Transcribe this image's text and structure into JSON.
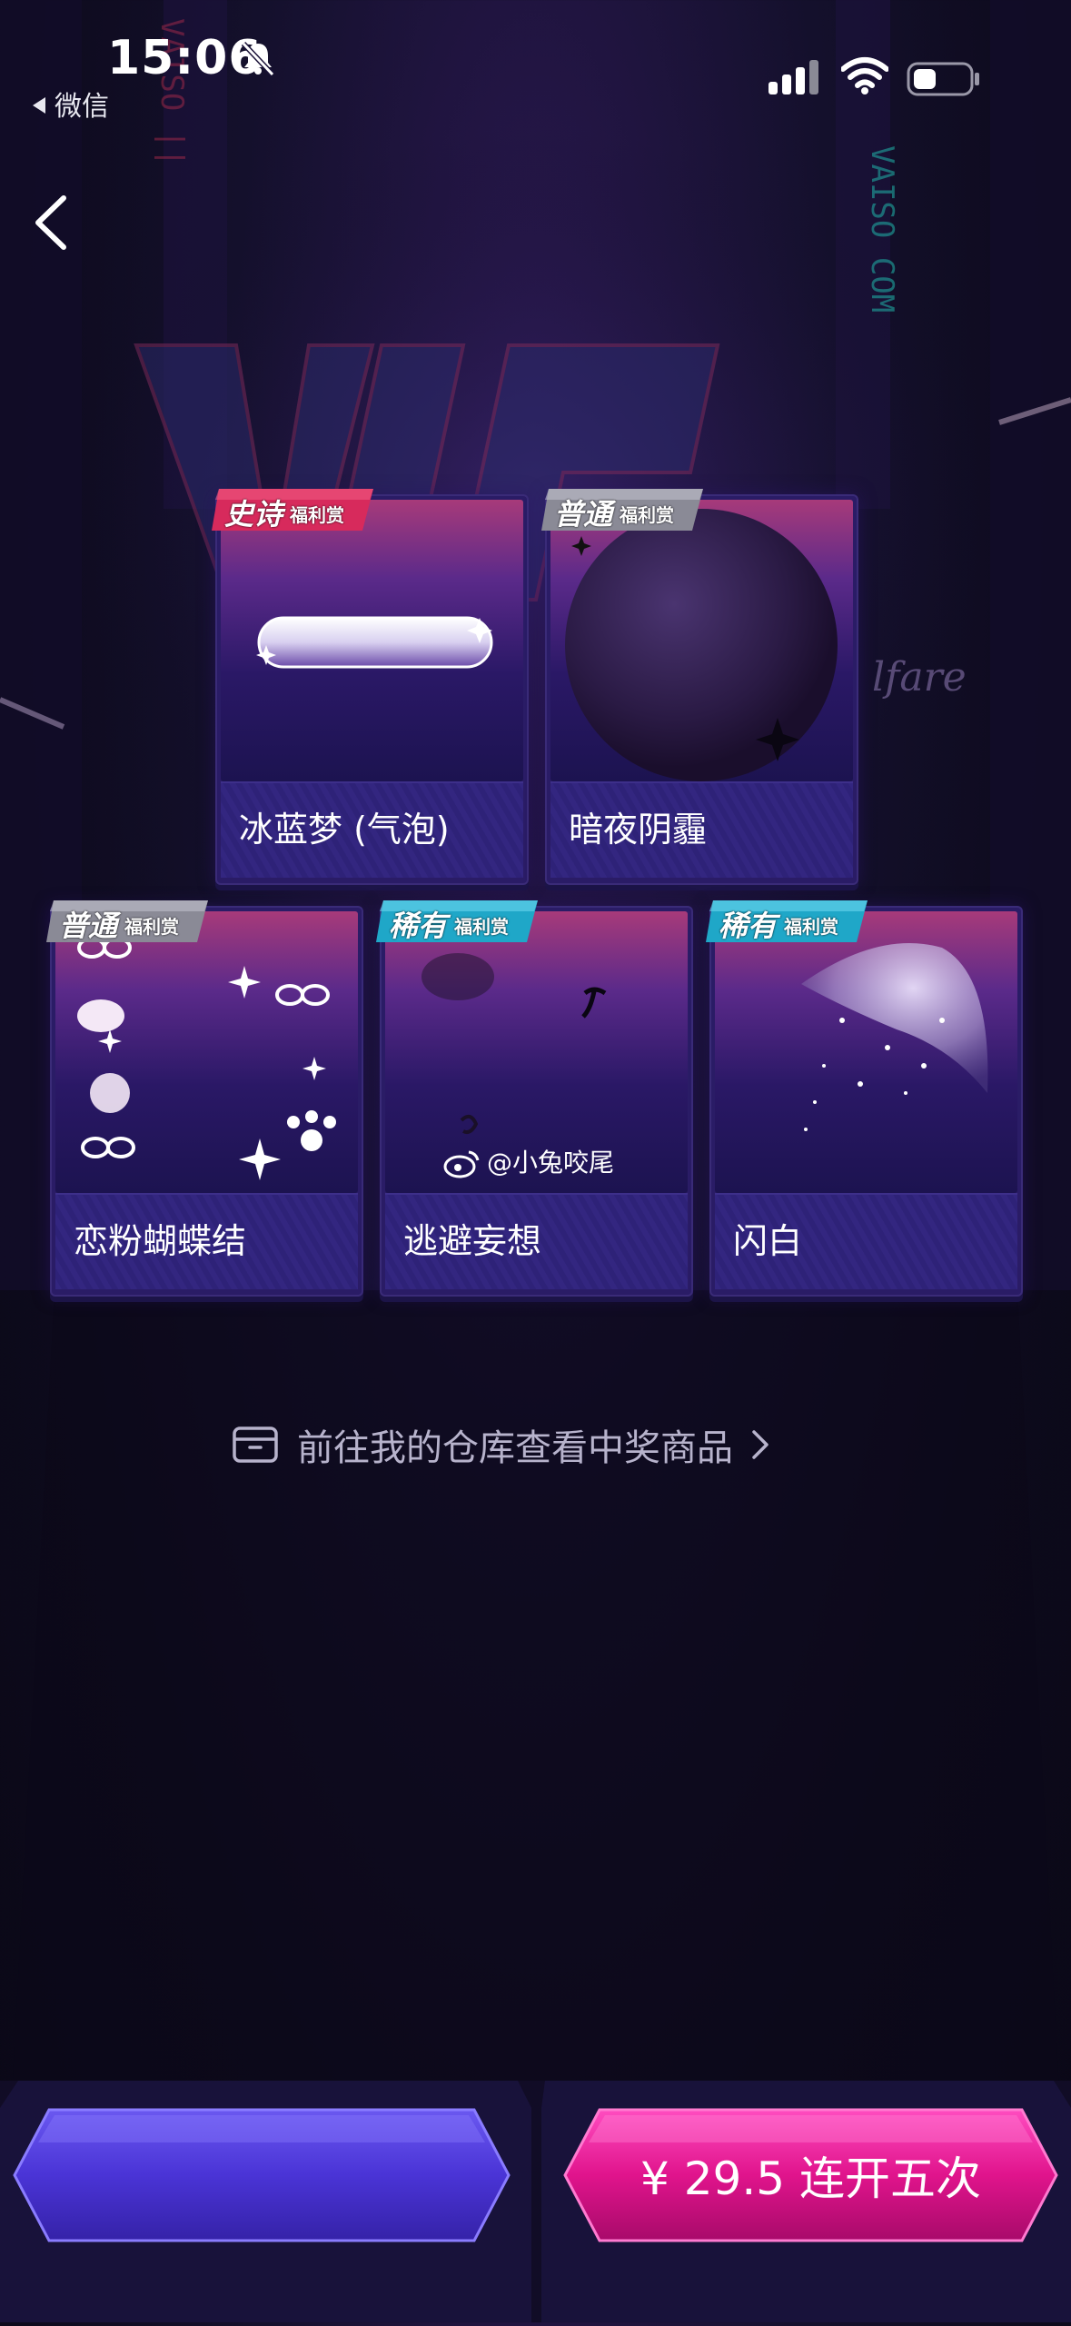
{
  "status_bar": {
    "time": "15:06",
    "back_app_label": "微信",
    "icons": [
      "bell-muted-icon",
      "signal-icon",
      "wifi-icon",
      "battery-icon"
    ]
  },
  "navigation": {
    "back_icon": "chevron-left-icon"
  },
  "badges": {
    "epic": {
      "big": "史诗",
      "small": "福利赏",
      "color": "#d72a5c"
    },
    "common": {
      "big": "普通",
      "small": "福利赏",
      "color": "#8a8a96"
    },
    "rare": {
      "big": "稀有",
      "small": "福利赏",
      "color": "#1fa7c8"
    }
  },
  "prizes": [
    {
      "name": "冰蓝梦 (气泡)",
      "rarity": "epic"
    },
    {
      "name": "暗夜阴霾",
      "rarity": "common"
    },
    {
      "name": "恋粉蝴蝶结",
      "rarity": "common"
    },
    {
      "name": "逃避妄想",
      "rarity": "rare"
    },
    {
      "name": "闪白",
      "rarity": "rare"
    }
  ],
  "watermark": "@小兔咬尾",
  "warehouse_link": {
    "label": "前往我的仓库查看中奖商品",
    "icon": "box-icon"
  },
  "buttons": {
    "left_label": "",
    "right_label": "¥ 29.5 连开五次",
    "right_color": "#e0148c",
    "left_color": "#4a34d6"
  }
}
